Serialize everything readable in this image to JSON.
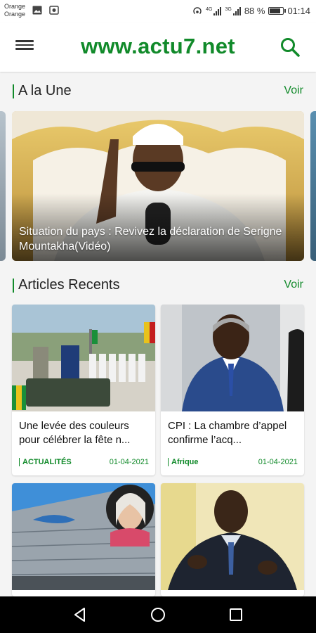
{
  "status_bar": {
    "carrier_1": "Orange",
    "carrier_2": "Orange",
    "sim_1": "4G",
    "sim_2": "3G",
    "battery": "88 %",
    "battery_level": 0.88,
    "time": "01:14"
  },
  "app_bar": {
    "title": "www.actu7.net",
    "menu_icon": "hamburger-menu-icon",
    "search_icon": "search-icon"
  },
  "headline_section": {
    "title": "A la Une",
    "more_label": "Voir",
    "slide_caption": "Situation du pays : Revivez la déclaration de Serigne Mountakha(Vidéo)"
  },
  "recent_section": {
    "title": "Articles Recents",
    "more_label": "Voir",
    "articles": [
      {
        "title": "Une levée des couleurs pour célébrer la fête n...",
        "category": "ACTUALITÉS",
        "date": "01-04-2021"
      },
      {
        "title": "CPI : La chambre d’appel confirme l’acq...",
        "category": "Afrique",
        "date": "01-04-2021"
      },
      {
        "title": "",
        "category": "",
        "date": ""
      },
      {
        "title": "",
        "category": "",
        "date": ""
      }
    ]
  },
  "nav_bar": {
    "back_icon": "back-triangle-icon",
    "home_icon": "home-circle-icon",
    "recents_icon": "recents-square-icon"
  },
  "colors": {
    "brand_green": "#118a2a",
    "text_dark": "#222222",
    "background": "#f4f4f4"
  }
}
